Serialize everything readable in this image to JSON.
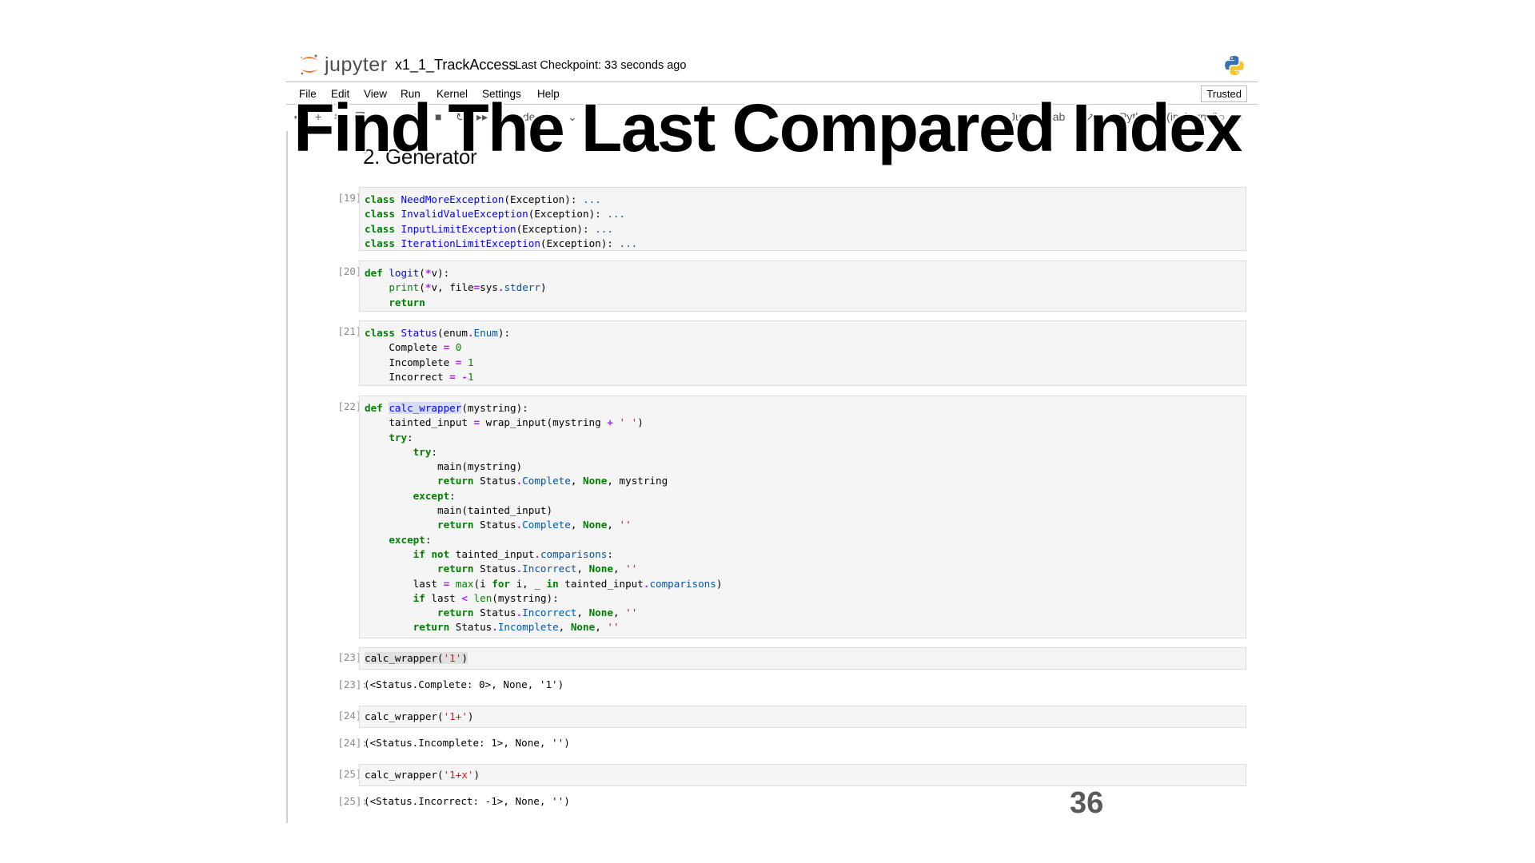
{
  "header": {
    "app_name": "jupyter",
    "notebook_title": "x1_1_TrackAccess",
    "checkpoint": "Last Checkpoint: 33 seconds ago"
  },
  "menu": {
    "items": [
      "File",
      "Edit",
      "View",
      "Run",
      "Kernel",
      "Settings",
      "Help"
    ],
    "trusted": "Trusted"
  },
  "toolbar": {
    "cell_type": "Code",
    "kernel": "Python 3 (ipykernel)",
    "jupyterlab": "JupyterLab"
  },
  "notebook": {
    "section_heading": "2. Generator",
    "prompts": [
      "[19]:",
      "[20]:",
      "[21]:",
      "[22]:",
      "[23]:",
      "[23]:",
      "[24]:",
      "[24]:",
      "[25]:",
      "[25]:"
    ],
    "outputs": [
      "(<Status.Complete: 0>, None, '1')",
      "(<Status.Incomplete: 1>, None, '')",
      "(<Status.Incorrect: -1>, None, '')"
    ]
  },
  "overlay_title": "Find The Last Compared Index",
  "slide_number": "36",
  "colors": {
    "keyword": "#008000",
    "builtin_name": "#0000ff",
    "string": "#ba2121",
    "number": "#008800",
    "operator": "#aa22ff",
    "cell_background": "#f5f5f5"
  }
}
